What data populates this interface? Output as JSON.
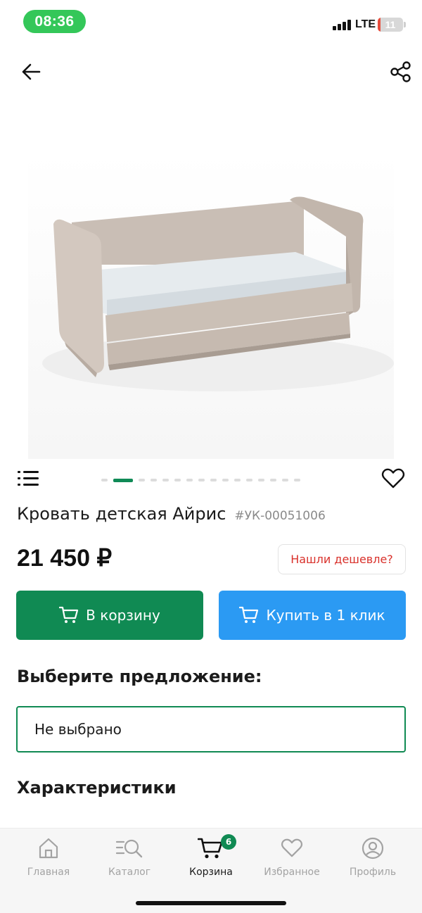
{
  "status_bar": {
    "time": "08:36",
    "network": "LTE",
    "battery_level": "11",
    "battery_fraction": 0.11
  },
  "top_bar": {
    "back_icon": "arrow-left-icon",
    "share_icon": "share-icon"
  },
  "gallery": {
    "image_subject": "sofa-bed-photo",
    "total_slides": 16,
    "active_slide": 1
  },
  "product": {
    "title": "Кровать детская Айрис",
    "sku": "#УК-00051006",
    "price": "21 450 ₽",
    "cheaper_label": "Нашли дешевле?"
  },
  "actions": {
    "cart_label": "В корзину",
    "one_click_label": "Купить в 1 клик"
  },
  "offer": {
    "heading": "Выберите предложение:",
    "selected": "Не выбрано"
  },
  "specs": {
    "heading": "Характеристики"
  },
  "colors": {
    "accent_green": "#108a53",
    "accent_blue": "#2b9af3",
    "alert_red": "#d9312b"
  },
  "tab_bar": {
    "tabs": [
      {
        "label": "Главная",
        "icon": "home-icon"
      },
      {
        "label": "Каталог",
        "icon": "catalog-search-icon"
      },
      {
        "label": "Корзина",
        "icon": "cart-icon",
        "badge": "6",
        "active": true
      },
      {
        "label": "Избранное",
        "icon": "heart-icon"
      },
      {
        "label": "Профиль",
        "icon": "profile-icon"
      }
    ]
  }
}
